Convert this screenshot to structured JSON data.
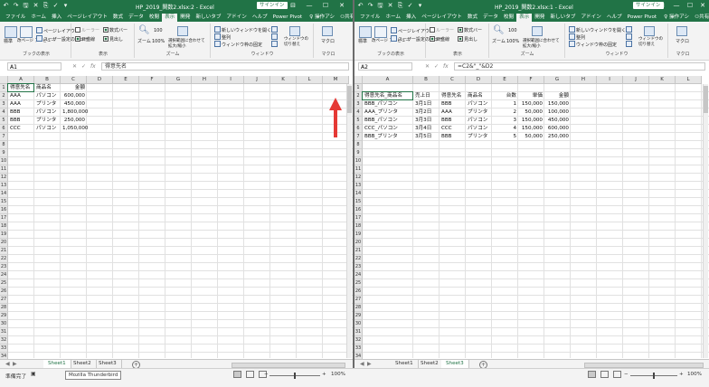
{
  "left": {
    "qat": [
      "↶",
      "↷",
      "🖫",
      "✕",
      "⎘",
      "✓",
      "▾"
    ],
    "title": "HP_2019_関数2.xlsx:2 - Excel",
    "signin": "サインイン",
    "tabs": [
      "ファイル",
      "ホーム",
      "挿入",
      "ページレイアウト",
      "数式",
      "データ",
      "校閲",
      "表示",
      "開発",
      "新しいタブ",
      "アドイン",
      "ヘルプ",
      "Power Pivot",
      "操作アシ",
      "共有"
    ],
    "active_tab": "表示",
    "ribbon": {
      "groups": [
        "ブックの表示",
        "表示",
        "ズーム",
        "ウィンドウ",
        "マクロ"
      ],
      "standard": "標準",
      "page_break": "改ページ\nプレビュー",
      "page_layout": "ページレイアウト",
      "user_view": "ユーザー設定のビュー",
      "ruler": "ルーラー",
      "formula_bar": "数式バー",
      "gridlines": "目盛線",
      "headings": "見出し",
      "zoom": "ズーム",
      "zoom100": "100%",
      "zoom_sel": "選択範囲に合わせて\n拡大/縮小",
      "new_window": "新しいウィンドウを開く",
      "arrange": "整列",
      "freeze": "ウィンドウ枠の固定",
      "switch": "ウィンドウの\n切り替え",
      "macro": "マクロ"
    },
    "namebox": "A1",
    "formula": "得意先名",
    "columns": [
      "A",
      "B",
      "C",
      "D",
      "E",
      "F",
      "G",
      "H",
      "I",
      "J",
      "K",
      "L",
      "M"
    ],
    "rows": [
      [
        "得意先名",
        "商品名",
        "金額"
      ],
      [
        "AAA",
        "パソコン",
        "600,000"
      ],
      [
        "AAA",
        "プリンタ",
        "450,000"
      ],
      [
        "BBB",
        "パソコン",
        "1,800,000"
      ],
      [
        "BBB",
        "プリンタ",
        "250,000"
      ],
      [
        "CCC",
        "パソコン",
        "1,050,000"
      ]
    ],
    "sheets": [
      "Sheet1",
      "Sheet2",
      "Sheet3"
    ],
    "active_sheet": "Sheet1"
  },
  "right": {
    "qat": [
      "↶",
      "↷",
      "🖫",
      "✕",
      "⎘",
      "✓",
      "▾"
    ],
    "title": "HP_2019_関数2.xlsx:1 - Excel",
    "signin": "サインイン",
    "tabs": [
      "ファイル",
      "ホーム",
      "挿入",
      "ページレイアウト",
      "数式",
      "データ",
      "校閲",
      "表示",
      "開発",
      "新しいタブ",
      "アドイン",
      "ヘルプ",
      "Power Pivot",
      "操作アシ",
      "共有"
    ],
    "active_tab": "表示",
    "namebox": "A2",
    "formula": "=C2&\"_\"&D2",
    "columns": [
      "A",
      "B",
      "C",
      "D",
      "E",
      "F",
      "G",
      "H",
      "I",
      "J",
      "K",
      "L"
    ],
    "rows": [
      [
        "",
        "",
        "",
        "",
        "",
        "",
        ""
      ],
      [
        "得意先名_商品名",
        "売上日",
        "得意先名",
        "商品名",
        "台数",
        "単価",
        "金額"
      ],
      [
        "BBB_パソコン",
        "3月1日",
        "BBB",
        "パソコン",
        "1",
        "150,000",
        "150,000"
      ],
      [
        "AAA_プリンタ",
        "3月2日",
        "AAA",
        "プリンタ",
        "2",
        "50,000",
        "100,000"
      ],
      [
        "BBB_パソコン",
        "3月3日",
        "BBB",
        "パソコン",
        "3",
        "150,000",
        "450,000"
      ],
      [
        "CCC_パソコン",
        "3月4日",
        "CCC",
        "パソコン",
        "4",
        "150,000",
        "600,000"
      ],
      [
        "BBB_プリンタ",
        "3月5日",
        "BBB",
        "プリンタ",
        "5",
        "50,000",
        "250,000"
      ]
    ],
    "sheets": [
      "Sheet1",
      "Sheet2",
      "Sheet3"
    ],
    "active_sheet": "Sheet3"
  },
  "status": {
    "ready": "準備完了",
    "tooltip": "Mozilla Thunderbird",
    "zoom_left": "100%",
    "zoom_right": "100%"
  },
  "colors": {
    "excel_green": "#217346",
    "arrow_red": "#e53935"
  }
}
